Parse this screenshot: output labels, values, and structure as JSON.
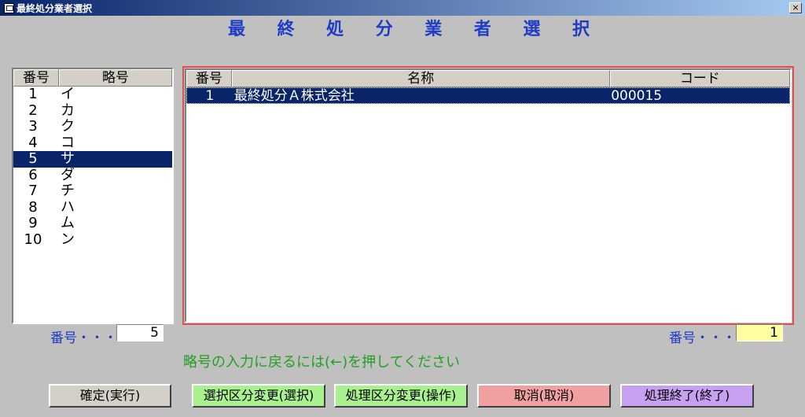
{
  "window": {
    "title": "最終処分業者選択",
    "close_label": "×"
  },
  "heading": [
    "最",
    "終",
    "処",
    "分",
    "業",
    "者",
    "選",
    "択"
  ],
  "left_list": {
    "headers": [
      "番号",
      "略号"
    ],
    "rows": [
      {
        "num": "1",
        "abbr": "イ"
      },
      {
        "num": "2",
        "abbr": "カ"
      },
      {
        "num": "3",
        "abbr": "ク"
      },
      {
        "num": "4",
        "abbr": "コ"
      },
      {
        "num": "5",
        "abbr": "サ"
      },
      {
        "num": "6",
        "abbr": "ダ"
      },
      {
        "num": "7",
        "abbr": "チ"
      },
      {
        "num": "8",
        "abbr": "ハ"
      },
      {
        "num": "9",
        "abbr": "ム"
      },
      {
        "num": "10",
        "abbr": "ン"
      }
    ],
    "selected_index": 4
  },
  "right_grid": {
    "headers": [
      "番号",
      "名称",
      "コード"
    ],
    "rows": [
      {
        "num": "1",
        "name": "最終処分Ａ株式会社",
        "code": "000015"
      }
    ]
  },
  "left_number": {
    "label": "番号・・・",
    "value": "5"
  },
  "right_number": {
    "label": "番号・・・",
    "value": "1"
  },
  "hint": "略号の入力に戻るには(←)を押してください",
  "buttons": {
    "confirm": "確定(実行)",
    "select_change": "選択区分変更(選択)",
    "process_change": "処理区分変更(操作)",
    "cancel": "取消(取消)",
    "finish": "処理終了(終了)"
  },
  "colors": {
    "confirm": "#d4d0c8",
    "select_change": "#a8f090",
    "process_change": "#a8f090",
    "cancel": "#f0a0a0",
    "finish": "#c8a0f0",
    "selection": "#0a246a",
    "accent_text": "#1e3cc8",
    "hint_text": "#22a022"
  }
}
